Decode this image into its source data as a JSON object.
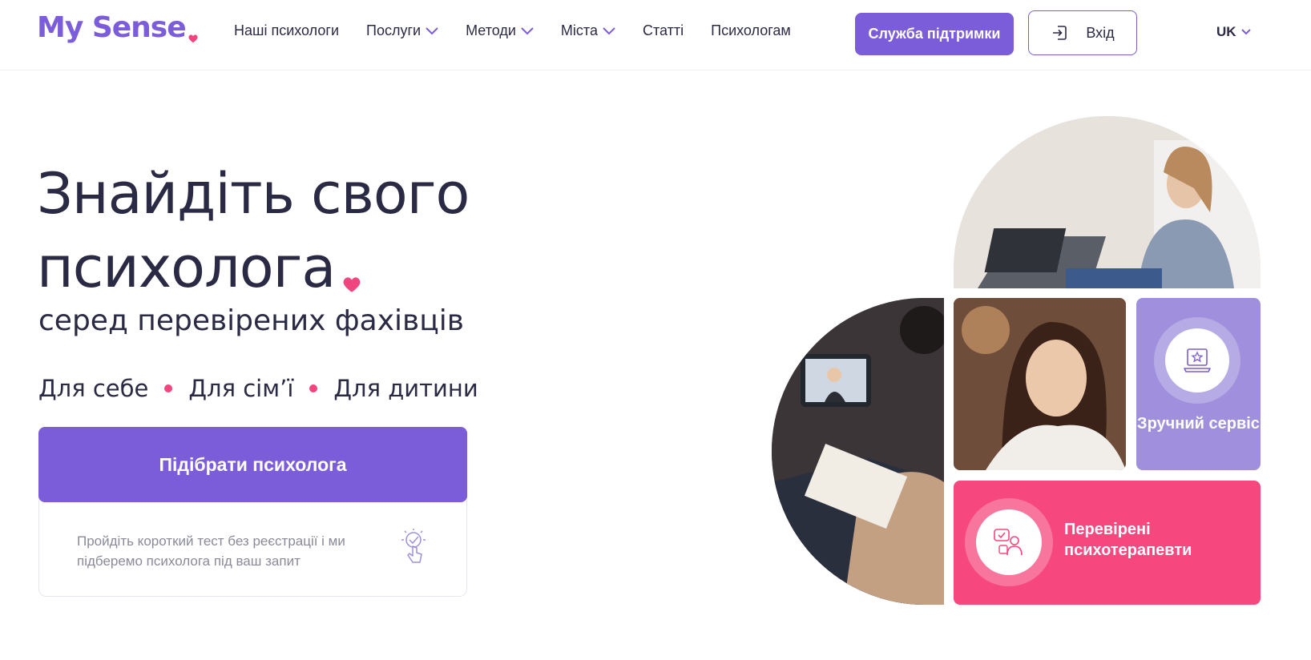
{
  "header": {
    "logo_text": "My Sense",
    "nav": [
      {
        "label": "Наші психологи",
        "dropdown": false
      },
      {
        "label": "Послуги",
        "dropdown": true
      },
      {
        "label": "Методи",
        "dropdown": true
      },
      {
        "label": "Міста",
        "dropdown": true
      },
      {
        "label": "Статті",
        "dropdown": false
      },
      {
        "label": "Психологам",
        "dropdown": false
      }
    ],
    "support_button": "Служба підтримки",
    "login_button": "Вхід",
    "language": "UK"
  },
  "hero": {
    "title_line1": "Знайдіть свого",
    "title_line2": "психолога",
    "subtitle": "серед перевірених фахівців",
    "audience": [
      "Для себе",
      "Для сім’ї",
      "Для дитини"
    ],
    "cta_button": "Підібрати психолога",
    "cta_note": "Пройдіть короткий тест без реєстрації і ми підберемо психолога під ваш запит"
  },
  "collage": {
    "service_label": "Зручний сервіс",
    "verified_label": "Перевірені психотерапевти"
  },
  "colors": {
    "brand": "#7b5cd9",
    "accent_pink": "#f6487e",
    "service_tile": "#9f8fdd",
    "text": "#2b2a45"
  },
  "icons": {
    "logo_heart": "heart-icon",
    "nav_chevron": "chevron-down-icon",
    "login": "login-icon",
    "cta_hint": "tap-hand-icon",
    "service": "laptop-star-icon",
    "verified": "chat-check-person-icon"
  }
}
